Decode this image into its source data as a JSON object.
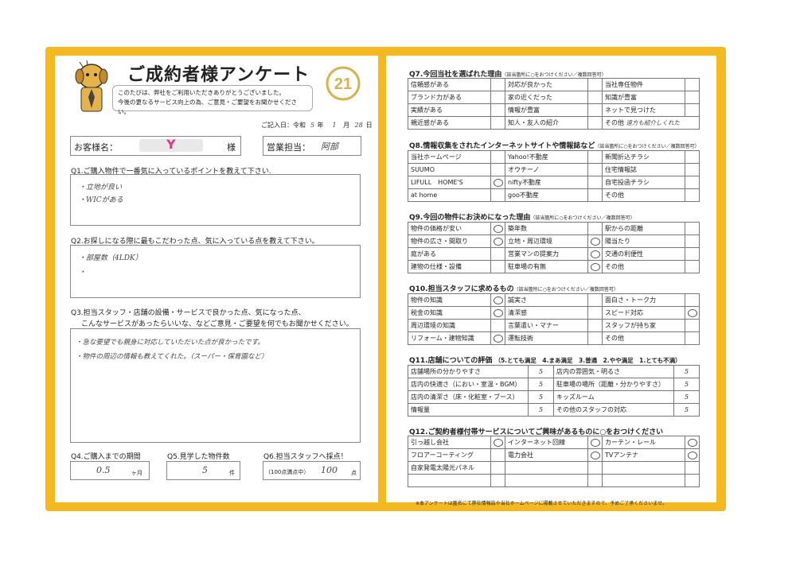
{
  "header": {
    "title": "ご成約者様アンケート",
    "greeting_1": "このたびは、弊社をご利用いただきありがとうございました。",
    "greeting_2": "今後の更なるサービス向上の為、ご意見・ご要望をお聞かせください。",
    "date_prefix": "ご記入日：令和",
    "date_year": "5",
    "date_year_unit": "年",
    "date_month": "1",
    "date_month_unit": "月",
    "date_day": "28",
    "date_day_unit": "日",
    "customer_label": "お客様名：",
    "customer_suffix": "様",
    "customer_mark": "Y",
    "staff_label": "営業担当：",
    "staff_value": "阿部",
    "logo_text": "21"
  },
  "q1": {
    "label": "Q1.ご購入物件で一番気に入っているポイントを教えて下さい.",
    "answer_1": "・立地が良い",
    "answer_2": "・WICがある"
  },
  "q2": {
    "label": "Q2.お探しになる際に最もこだわった点、気に入っている点を教えて下さい。",
    "answer_1": "・部屋数（4LDK）",
    "answer_2": "・"
  },
  "q3": {
    "label_1": "Q3.担当スタッフ・店舗の設備・サービスで良かった点、気になった点、",
    "label_2": "こんなサービスがあったらいいな、などご意見・ご要望を何でもお聞かせください。",
    "answer_1": "・急な要望でも親身に対応していただいた点が良かったです。",
    "answer_2": "・物件の周辺の情報も教えてくれた。（スーパー・保育園など）"
  },
  "q4": {
    "label": "Q4.ご購入までの期間",
    "value": "0.5",
    "unit": "ヶ月"
  },
  "q5": {
    "label": "Q5.見学した物件数",
    "value": "5",
    "unit": "件"
  },
  "q6": {
    "label": "Q6.担当スタッフへ採点！",
    "prefix": "（100点満点中）",
    "value": "100",
    "unit": "点"
  },
  "q7": {
    "label": "Q7.今回当社を選ばれた理由",
    "note": "（該当箇所に○をおつけください／複数回答可）",
    "rows": [
      [
        "信頼感がある",
        "対応が良かった",
        "当社専任物件"
      ],
      [
        "ブランド力がある",
        "家の近くだった",
        "知識が豊富"
      ],
      [
        "実績がある",
        "情報が豊富",
        "ネットで見つけた"
      ],
      [
        "親近感がある",
        "知人・友人の紹介",
        "その他"
      ]
    ],
    "other_value": "遠方も紹介しくれた"
  },
  "q8": {
    "label": "Q8.情報収集をされたインターネットサイトや情報誌など",
    "note": "（該当箇所に○をおつけください／複数回答可）",
    "rows": [
      [
        "当社ホームページ",
        "Yahoo!不動産",
        "新聞折込チラシ"
      ],
      [
        "SUUMO",
        "オウチーノ",
        "住宅情報誌"
      ],
      [
        "LIFULL　HOME'S",
        "nifty不動産",
        "自宅投函チラシ"
      ],
      [
        "at home",
        "goo不動産",
        "その他"
      ]
    ]
  },
  "q9": {
    "label": "Q9.今回の物件にお決めになった理由",
    "note": "（該当箇所に○をおつけください／複数回答可）",
    "rows": [
      [
        "物件の価格が安い",
        "築年数",
        "駅からの距離"
      ],
      [
        "物件の広さ・間取り",
        "立地・周辺環境",
        "陽当たり"
      ],
      [
        "庭がある",
        "営業マンの提案力",
        "交通の利便性"
      ],
      [
        "建物の仕様・設備",
        "駐車場の有無",
        "その他"
      ]
    ]
  },
  "q10": {
    "label": "Q10.担当スタッフに求めるもの",
    "note": "（該当箇所に○をおつけください／複数回答可）",
    "rows": [
      [
        "物件の知識",
        "誠実さ",
        "面白さ・トーク力"
      ],
      [
        "税金の知識",
        "清潔感",
        "スピード対応"
      ],
      [
        "周辺環境の知識",
        "言葉遣い・マナー",
        "スタッフが持ち家"
      ],
      [
        "リフォーム・建物知識",
        "運転技術",
        "その他"
      ]
    ]
  },
  "q11": {
    "label": "Q11.店舗についての評価",
    "scale": "（5.とても満足　4.まあ満足　3.普通　2.やや満足　1.とても不満）",
    "rows": [
      [
        "店舗場所の分かりやすさ",
        "5",
        "店内の雰囲気・明るさ",
        "5"
      ],
      [
        "店内の快適さ（におい・室温・BGM）",
        "5",
        "駐車場の場所（距離・分かりやすさ）",
        "5"
      ],
      [
        "店内の清潔さ（床・化粧室・ブース）",
        "5",
        "キッズルーム",
        "5"
      ],
      [
        "情報量",
        "5",
        "その他のスタッフの対応",
        "5"
      ]
    ]
  },
  "q12": {
    "label": "Q12.ご契約者様付帯サービスについてご興味があるものに○をおつけください",
    "rows": [
      [
        "引っ越し会社",
        "インターネット回線",
        "カーテン・レール"
      ],
      [
        "フロアーコーティング",
        "電力会社",
        "TVアンテナ"
      ],
      [
        "自家発電太陽光パネル",
        "",
        ""
      ],
      [
        "",
        "",
        ""
      ]
    ]
  },
  "footer": {
    "note": "※本アンケートは匿名にて弊社情報誌や当社ホームページに掲載させていただきますので、予めご了承くださいませ。"
  }
}
